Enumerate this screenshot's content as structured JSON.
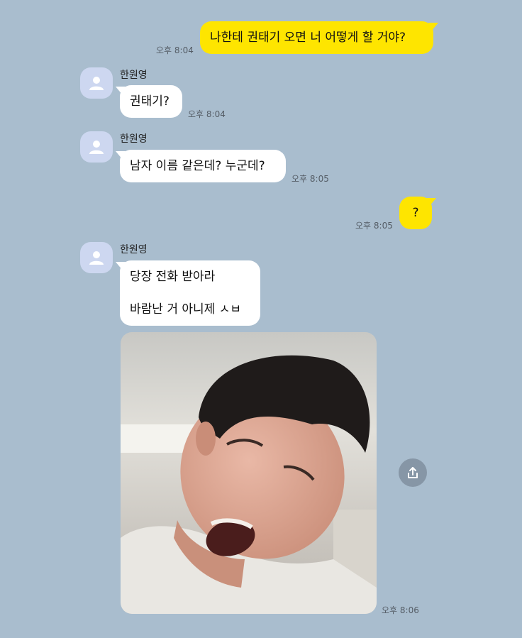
{
  "colors": {
    "background": "#a9bdce",
    "my_bubble": "#fee500",
    "their_bubble": "#ffffff"
  },
  "messages": [
    {
      "side": "me",
      "text": "나한테 권태기 오면 너 어떻게 할 거야?",
      "time": "오후 8:04"
    },
    {
      "side": "other",
      "sender": "한원영",
      "text": "권태기?",
      "time": "오후 8:04"
    },
    {
      "side": "other",
      "sender": "한원영",
      "text": "남자 이름 같은데? 누군데?",
      "time": "오후 8:05"
    },
    {
      "side": "me",
      "text": "?",
      "time": "오후 8:05"
    },
    {
      "side": "other",
      "sender": "한원영",
      "lines": [
        "당장 전화 받아라",
        "바람난 거 아니제 ㅅㅂ"
      ],
      "image": "photo of a man with open mouth",
      "time": "오후 8:06"
    }
  ],
  "icons": {
    "avatar": "default-profile-icon",
    "share": "share-icon"
  }
}
